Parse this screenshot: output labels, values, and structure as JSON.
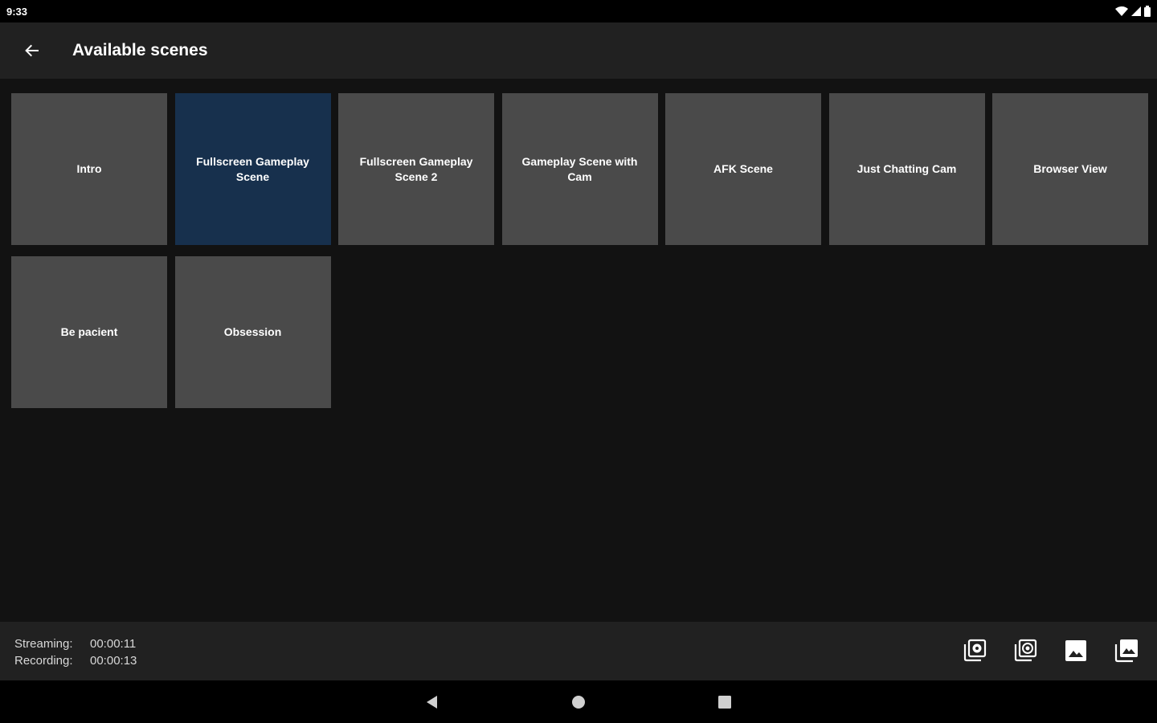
{
  "status_bar": {
    "time": "9:33",
    "icons": [
      "wifi-icon",
      "signal-icon",
      "battery-icon"
    ]
  },
  "app_bar": {
    "title": "Available scenes",
    "back_icon": "arrow-back-icon"
  },
  "scenes": [
    {
      "label": "Intro",
      "active": false
    },
    {
      "label": "Fullscreen Gameplay Scene",
      "active": true
    },
    {
      "label": "Fullscreen Gameplay Scene 2",
      "active": false
    },
    {
      "label": "Gameplay Scene with Cam",
      "active": false
    },
    {
      "label": "AFK Scene",
      "active": false
    },
    {
      "label": "Just Chatting Cam",
      "active": false
    },
    {
      "label": "Browser View",
      "active": false
    },
    {
      "label": "Be pacient",
      "active": false
    },
    {
      "label": "Obsession",
      "active": false
    }
  ],
  "bottom_bar": {
    "streaming_label": "Streaming:",
    "streaming_time": "00:00:11",
    "recording_label": "Recording:",
    "recording_time": "00:00:13",
    "actions": [
      "scene-settings-icon",
      "source-settings-icon",
      "image-icon",
      "image-library-icon"
    ]
  },
  "nav_bar": {
    "icons": [
      "nav-back-icon",
      "nav-home-icon",
      "nav-recents-icon"
    ]
  },
  "colors": {
    "active_tile": "#17304d",
    "tile": "#4a4a4a",
    "background": "#121212",
    "bar": "#212121"
  }
}
